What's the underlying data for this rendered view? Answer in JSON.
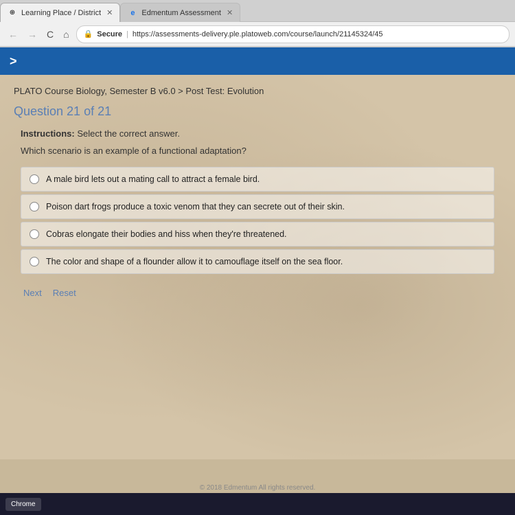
{
  "browser": {
    "tabs": [
      {
        "id": "tab1",
        "label": "Learning Place / District",
        "favicon": "⊕",
        "active": true,
        "closable": true
      },
      {
        "id": "tab2",
        "label": "Edmentum Assessment",
        "favicon": "e",
        "active": false,
        "closable": true
      }
    ],
    "address_bar": {
      "secure_label": "Secure",
      "url": "https://assessments-delivery.ple.platoweb.com/course/launch/21145324/45"
    },
    "nav": {
      "back": "←",
      "forward": "→",
      "refresh": "C",
      "home": "⌂"
    }
  },
  "toolbar": {
    "chevron": ">"
  },
  "content": {
    "breadcrumb": "PLATO Course Biology, Semester B v6.0 > Post Test: Evolution",
    "question_number": "Question 21 of 21",
    "instructions_label": "Instructions:",
    "instructions_text": "Select the correct answer.",
    "question_text": "Which scenario is an example of a functional adaptation?",
    "options": [
      {
        "id": "A",
        "text": "A male bird lets out a mating call to attract a female bird."
      },
      {
        "id": "B",
        "text": "Poison dart frogs produce a toxic venom that they can secrete out of their skin."
      },
      {
        "id": "C",
        "text": "Cobras elongate their bodies and hiss when they're threatened."
      },
      {
        "id": "D",
        "text": "The color and shape of a flounder allow it to camouflage itself on the sea floor."
      }
    ],
    "buttons": {
      "next": "Next",
      "reset": "Reset"
    }
  },
  "footer": {
    "text": "© 2018 Edmentum  All rights reserved."
  }
}
